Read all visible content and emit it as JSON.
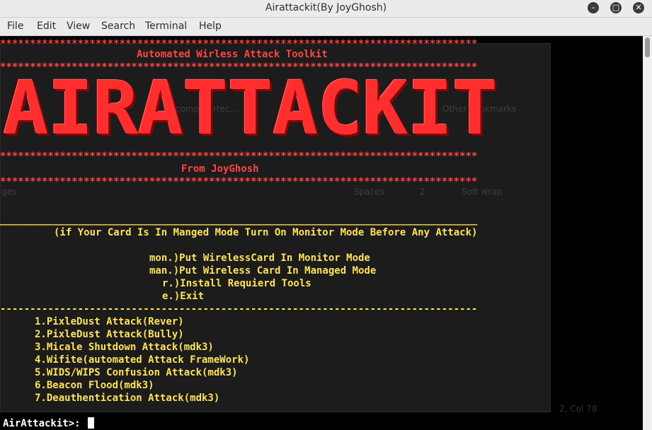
{
  "window": {
    "title": "Airattackit(By JoyGhosh)",
    "controls": [
      "minimize",
      "maximize",
      "close"
    ]
  },
  "menu": [
    "File",
    "Edit",
    "View",
    "Search",
    "Terminal",
    "Help"
  ],
  "banner": {
    "stars": "********************************************************************************",
    "subtitle": "Automated Wirless Attack Toolkit",
    "logo": "AIRATTACKIT",
    "author": "From JoyGhosh",
    "underline": "________________________________________________________________________________",
    "dashes": "--------------------------------------------------------------------------------"
  },
  "notice": "(if Your Card Is In Manged Mode Turn On Monitor Mode Before Any Attack)",
  "setup_options": [
    "mon.)Put WirelessCard In Monitor Mode",
    "man.)Put Wireless Card In Managed Mode",
    "r.)Install Requierd Tools",
    "e.)Exit"
  ],
  "attacks": [
    "1.PixleDust Attack(Rever)",
    "2.PixleDust Attack(Bully)",
    "3.Micale Shutdown Attack(mdk3)",
    "4.Wifite(automated Attack FrameWork)",
    "5.WIDS/WIPS Confusion Attack(mdk3)",
    "6.Beacon Flood(mdk3)",
    "7.Deauthentication Attack(mdk3)"
  ],
  "prompt": "AirAttackit>: ",
  "background_ghost": {
    "spaces": "Spaces",
    "indent": "2",
    "wrap": "Soft wrap",
    "bookmark": "computertec...",
    "other_bookmarks": "Other bookmarks",
    "status": "2, Col 78",
    "ges": "ges"
  }
}
